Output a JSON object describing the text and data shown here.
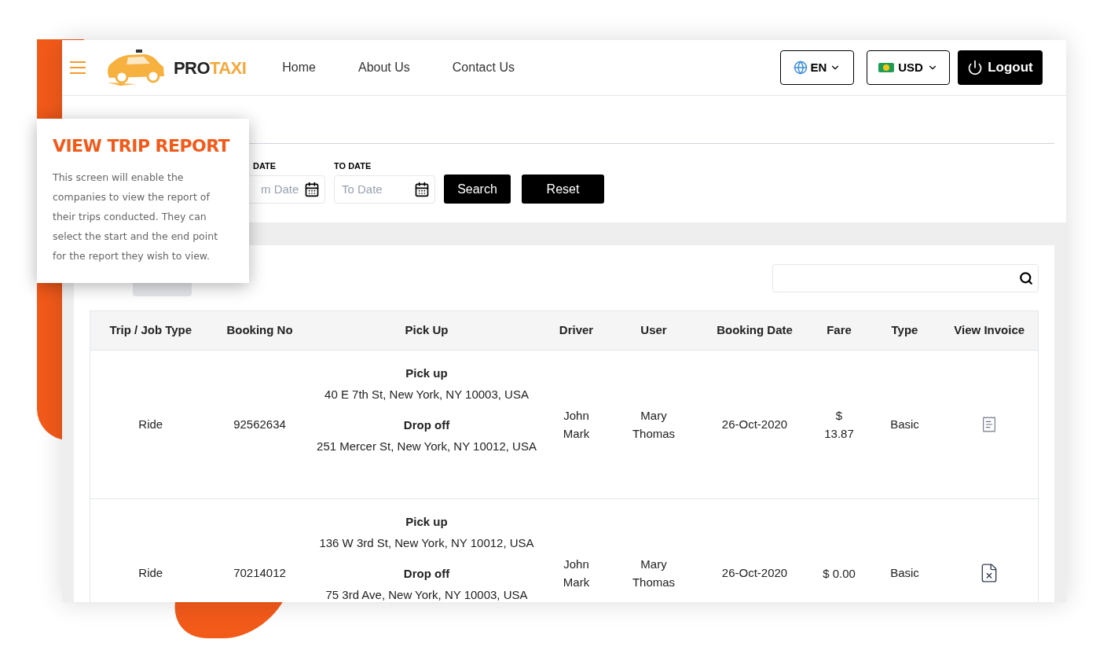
{
  "brand": {
    "name_dark": "PRO",
    "name_accent": "TAXI"
  },
  "nav": [
    {
      "label": "Home"
    },
    {
      "label": "About Us"
    },
    {
      "label": "Contact Us"
    }
  ],
  "language": {
    "label": "EN"
  },
  "currency": {
    "label": "USD"
  },
  "logout": {
    "label": "Logout"
  },
  "filters": {
    "from_label": "DATE",
    "from_placeholder": "m Date",
    "to_label": "TO DATE",
    "to_placeholder": "To Date",
    "search": "Search",
    "reset": "Reset"
  },
  "table": {
    "columns": [
      "Trip / Job Type",
      "Booking No",
      "Pick Up",
      "Driver",
      "User",
      "Booking Date",
      "Fare",
      "Type",
      "View Invoice"
    ],
    "rows": [
      {
        "trip_type": "Ride",
        "booking_no": "92562634",
        "pickup_label": "Pick up",
        "pickup": "40 E 7th St, New York, NY 10003, USA",
        "dropoff_label": "Drop off",
        "dropoff": "251 Mercer St, New York, NY 10012, USA",
        "driver": "John Mark",
        "user": "Mary Thomas",
        "booking_date": "26-Oct-2020",
        "fare": "$ 13.87",
        "type": "Basic",
        "invoice": {
          "kind": "receipt"
        }
      },
      {
        "trip_type": "Ride",
        "booking_no": "70214012",
        "pickup_label": "Pick up",
        "pickup": "136 W 3rd St, New York, NY 10012, USA",
        "dropoff_label": "Drop off",
        "dropoff": "75 3rd Ave, New York, NY 10003, USA",
        "driver": "John Mark",
        "user": "Mary Thomas",
        "booking_date": "26-Oct-2020",
        "fare": "$ 0.00",
        "type": "Basic",
        "invoice": {
          "kind": "cancelled"
        }
      }
    ]
  },
  "callout": {
    "title": "VIEW TRIP REPORT",
    "text": "This screen will enable the companies to view the report of their trips conducted. They can select the start and the end point for the report they wish to view."
  }
}
